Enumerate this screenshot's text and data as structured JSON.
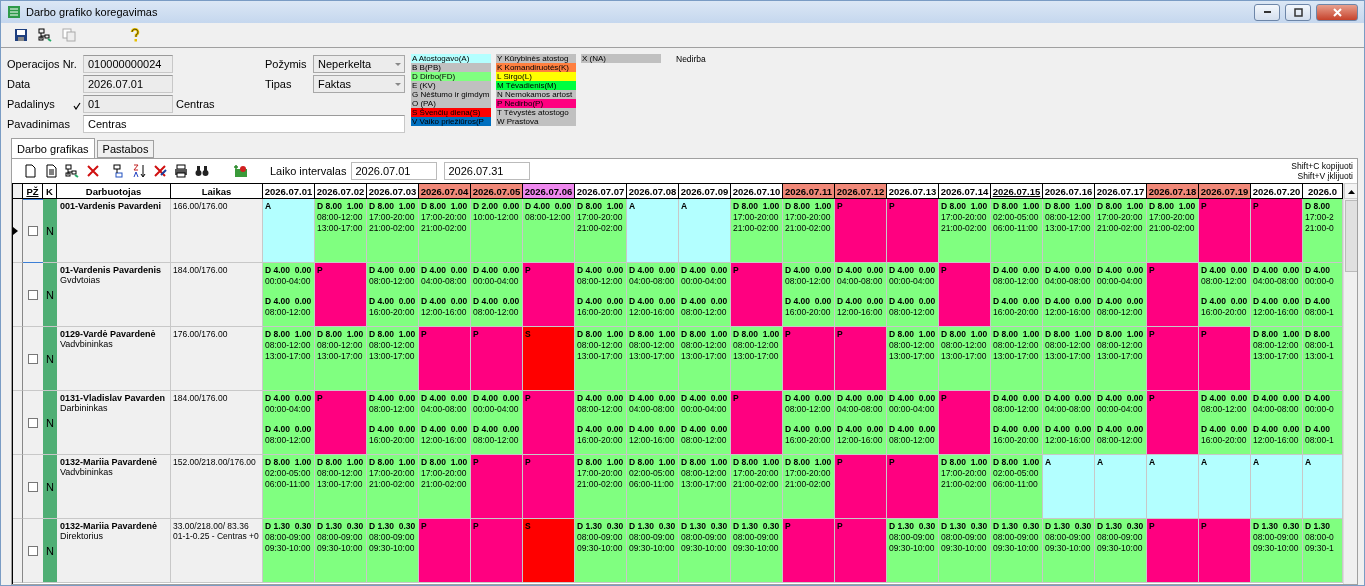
{
  "window": {
    "title": "Darbo grafiko koregavimas"
  },
  "form": {
    "operation_no": {
      "label": "Operacijos Nr.",
      "value": "010000000024"
    },
    "date": {
      "label": "Data",
      "value": "2026.07.01"
    },
    "unit": {
      "label": "Padalinys",
      "code": "01",
      "name": "Centras"
    },
    "title_field": {
      "label": "Pavadinimas",
      "value": "Centras"
    },
    "sign": {
      "label": "Požymis",
      "value": "Neperkelta"
    },
    "type": {
      "label": "Tipas",
      "value": "Faktas"
    }
  },
  "legend": {
    "columns": [
      [
        {
          "text": "A Atostogavo(A)",
          "color": "#b3ffff"
        },
        {
          "text": "B B(PB)",
          "color": "#c0c0c0"
        },
        {
          "text": "D Dirbo(FD)",
          "color": "#80ff80"
        },
        {
          "text": "E (KV)",
          "color": "#c0c0c0"
        },
        {
          "text": "G Nėštumo ir gimdym",
          "color": "#c0c0c0"
        },
        {
          "text": "O (PA)",
          "color": "#c0c0c0"
        },
        {
          "text": "S Švenčių diena(S)",
          "color": "#ff0000"
        },
        {
          "text": "V Vaiko priežiūros(P",
          "color": "#0070c0"
        }
      ],
      [
        {
          "text": "Y Kūrybinės atostog",
          "color": "#c0c0c0"
        },
        {
          "text": "K Komandiruotės(K)",
          "color": "#ff8040"
        },
        {
          "text": "L Sirgo(L)",
          "color": "#ffff00"
        },
        {
          "text": "M Tėvadienis(M)",
          "color": "#00ff40"
        },
        {
          "text": "N Nemokamos artost",
          "color": "#c0c0c0"
        },
        {
          "text": "P Nedirbo(P)",
          "color": "#ff0080"
        },
        {
          "text": "T Tėvystės atostogo",
          "color": "#c0c0c0"
        },
        {
          "text": "W Prastova",
          "color": "#c0c0c0"
        }
      ],
      [
        {
          "text": "X (NA)",
          "color": "#c0c0c0"
        }
      ]
    ],
    "note": "Nedirba"
  },
  "tabs": [
    {
      "label": "Darbo grafikas",
      "selected": true
    },
    {
      "label": "Pastabos",
      "selected": false
    }
  ],
  "schedule": {
    "interval": {
      "label": "Laiko intervalas",
      "from": "2026.07.01",
      "to": "2026.07.31"
    },
    "hints": [
      "Shift+C kopijuoti",
      "Shift+V įklijuoti"
    ],
    "columns": {
      "check": "PŽ",
      "k": "K",
      "employee": "Darbuotojas",
      "hours": "Laikas"
    },
    "dates": [
      {
        "label": "2026.07.01",
        "kind": "weekday"
      },
      {
        "label": "2026.07.02",
        "kind": "weekday"
      },
      {
        "label": "2026.07.03",
        "kind": "weekday"
      },
      {
        "label": "2026.07.04",
        "kind": "weekend"
      },
      {
        "label": "2026.07.05",
        "kind": "weekend"
      },
      {
        "label": "2026.07.06",
        "kind": "holiday"
      },
      {
        "label": "2026.07.07",
        "kind": "weekday"
      },
      {
        "label": "2026.07.08",
        "kind": "weekday"
      },
      {
        "label": "2026.07.09",
        "kind": "weekday"
      },
      {
        "label": "2026.07.10",
        "kind": "weekday"
      },
      {
        "label": "2026.07.11",
        "kind": "weekend"
      },
      {
        "label": "2026.07.12",
        "kind": "weekend"
      },
      {
        "label": "2026.07.13",
        "kind": "weekday"
      },
      {
        "label": "2026.07.14",
        "kind": "weekday"
      },
      {
        "label": "2026.07.15",
        "kind": "today"
      },
      {
        "label": "2026.07.16",
        "kind": "weekday"
      },
      {
        "label": "2026.07.17",
        "kind": "weekday"
      },
      {
        "label": "2026.07.18",
        "kind": "weekend"
      },
      {
        "label": "2026.07.19",
        "kind": "weekend"
      },
      {
        "label": "2026.07.20",
        "kind": "weekday"
      },
      {
        "label": "2026.0",
        "kind": "weekday"
      }
    ],
    "rows": [
      {
        "selected": true,
        "checked": false,
        "k": "N",
        "name": "001-Vardenis Pavardeni",
        "hours": [
          "166.00/176.00"
        ],
        "cells": [
          {
            "kind": "absence",
            "blocks": [
              [
                "A"
              ]
            ]
          },
          {
            "kind": "work",
            "blocks": [
              [
                "D 8.00  1.00",
                "08:00-12:00",
                "13:00-17:00"
              ]
            ]
          },
          {
            "kind": "work",
            "blocks": [
              [
                "D 8.00  1.00",
                "17:00-20:00",
                "21:00-02:00"
              ]
            ]
          },
          {
            "kind": "work",
            "blocks": [
              [
                "D 8.00  1.00",
                "17:00-20:00",
                "21:00-02:00"
              ]
            ]
          },
          {
            "kind": "work",
            "blocks": [
              [
                "D 2.00  0.00",
                "10:00-12:00"
              ]
            ]
          },
          {
            "kind": "work",
            "blocks": [
              [
                "D 4.00  0.00",
                "08:00-12:00"
              ]
            ]
          },
          {
            "kind": "work",
            "blocks": [
              [
                "D 8.00  1.00",
                "17:00-20:00",
                "21:00-02:00"
              ]
            ]
          },
          {
            "kind": "absence",
            "blocks": [
              [
                "A"
              ]
            ]
          },
          {
            "kind": "absence",
            "blocks": [
              [
                "A"
              ]
            ]
          },
          {
            "kind": "work",
            "blocks": [
              [
                "D 8.00  1.00",
                "17:00-20:00",
                "21:00-02:00"
              ]
            ]
          },
          {
            "kind": "work",
            "blocks": [
              [
                "D 8.00  1.00",
                "17:00-20:00",
                "21:00-02:00"
              ]
            ]
          },
          {
            "kind": "off",
            "blocks": [
              [
                "P"
              ]
            ]
          },
          {
            "kind": "off",
            "blocks": [
              [
                "P"
              ]
            ]
          },
          {
            "kind": "work",
            "blocks": [
              [
                "D 8.00  1.00",
                "17:00-20:00",
                "21:00-02:00"
              ]
            ]
          },
          {
            "kind": "work",
            "blocks": [
              [
                "D 8.00  1.00",
                "02:00-05:00",
                "06:00-11:00"
              ]
            ]
          },
          {
            "kind": "work",
            "blocks": [
              [
                "D 8.00  1.00",
                "08:00-12:00",
                "13:00-17:00"
              ]
            ]
          },
          {
            "kind": "work",
            "blocks": [
              [
                "D 8.00  1.00",
                "17:00-20:00",
                "21:00-02:00"
              ]
            ]
          },
          {
            "kind": "work",
            "blocks": [
              [
                "D 8.00  1.00",
                "17:00-20:00",
                "21:00-02:00"
              ]
            ]
          },
          {
            "kind": "off",
            "blocks": [
              [
                "P"
              ]
            ]
          },
          {
            "kind": "off",
            "blocks": [
              [
                "P"
              ]
            ]
          },
          {
            "kind": "work",
            "blocks": [
              [
                "D 8.00",
                "17:00-2",
                "21:00-0"
              ]
            ]
          }
        ]
      },
      {
        "selected": false,
        "checked": false,
        "k": "N",
        "name": "01-Vardenis Pavardenis",
        "role": "Gvdvtoias",
        "hours": [
          "184.00/176.00"
        ],
        "cells": [
          {
            "kind": "work",
            "blocks": [
              [
                "D 4.00  0.00",
                "00:00-04:00"
              ],
              [
                "D 4.00  0.00",
                "08:00-12:00"
              ]
            ]
          },
          {
            "kind": "off",
            "blocks": [
              [
                "P"
              ]
            ]
          },
          {
            "kind": "work",
            "blocks": [
              [
                "D 4.00  0.00",
                "08:00-12:00"
              ],
              [
                "D 4.00  0.00",
                "16:00-20:00"
              ]
            ]
          },
          {
            "kind": "work",
            "blocks": [
              [
                "D 4.00  0.00",
                "04:00-08:00"
              ],
              [
                "D 4.00  0.00",
                "12:00-16:00"
              ]
            ]
          },
          {
            "kind": "work",
            "blocks": [
              [
                "D 4.00  0.00",
                "00:00-04:00"
              ],
              [
                "D 4.00  0.00",
                "08:00-12:00"
              ]
            ]
          },
          {
            "kind": "off",
            "blocks": [
              [
                "P"
              ]
            ]
          },
          {
            "kind": "work",
            "blocks": [
              [
                "D 4.00  0.00",
                "08:00-12:00"
              ],
              [
                "D 4.00  0.00",
                "16:00-20:00"
              ]
            ]
          },
          {
            "kind": "work",
            "blocks": [
              [
                "D 4.00  0.00",
                "04:00-08:00"
              ],
              [
                "D 4.00  0.00",
                "12:00-16:00"
              ]
            ]
          },
          {
            "kind": "work",
            "blocks": [
              [
                "D 4.00  0.00",
                "00:00-04:00"
              ],
              [
                "D 4.00  0.00",
                "08:00-12:00"
              ]
            ]
          },
          {
            "kind": "off",
            "blocks": [
              [
                "P"
              ]
            ]
          },
          {
            "kind": "work",
            "blocks": [
              [
                "D 4.00  0.00",
                "08:00-12:00"
              ],
              [
                "D 4.00  0.00",
                "16:00-20:00"
              ]
            ]
          },
          {
            "kind": "work",
            "blocks": [
              [
                "D 4.00  0.00",
                "04:00-08:00"
              ],
              [
                "D 4.00  0.00",
                "12:00-16:00"
              ]
            ]
          },
          {
            "kind": "work",
            "blocks": [
              [
                "D 4.00  0.00",
                "00:00-04:00"
              ],
              [
                "D 4.00  0.00",
                "08:00-12:00"
              ]
            ]
          },
          {
            "kind": "off",
            "blocks": [
              [
                "P"
              ]
            ]
          },
          {
            "kind": "work",
            "blocks": [
              [
                "D 4.00  0.00",
                "08:00-12:00"
              ],
              [
                "D 4.00  0.00",
                "16:00-20:00"
              ]
            ]
          },
          {
            "kind": "work",
            "blocks": [
              [
                "D 4.00  0.00",
                "04:00-08:00"
              ],
              [
                "D 4.00  0.00",
                "12:00-16:00"
              ]
            ]
          },
          {
            "kind": "work",
            "blocks": [
              [
                "D 4.00  0.00",
                "00:00-04:00"
              ],
              [
                "D 4.00  0.00",
                "08:00-12:00"
              ]
            ]
          },
          {
            "kind": "off",
            "blocks": [
              [
                "P"
              ]
            ]
          },
          {
            "kind": "work",
            "blocks": [
              [
                "D 4.00  0.00",
                "08:00-12:00"
              ],
              [
                "D 4.00  0.00",
                "16:00-20:00"
              ]
            ]
          },
          {
            "kind": "work",
            "blocks": [
              [
                "D 4.00  0.00",
                "04:00-08:00"
              ],
              [
                "D 4.00  0.00",
                "12:00-16:00"
              ]
            ]
          },
          {
            "kind": "work",
            "blocks": [
              [
                "D 4.00",
                "00:00-0"
              ],
              [
                "D 4.00",
                "08:00-1"
              ]
            ]
          }
        ]
      },
      {
        "selected": false,
        "checked": false,
        "k": "N",
        "name": "0129-Vardė Pavardenė",
        "role": "Vadvbininkas",
        "hours": [
          "176.00/176.00"
        ],
        "cells": [
          {
            "kind": "work",
            "blocks": [
              [
                "D 8.00  1.00",
                "08:00-12:00",
                "13:00-17:00"
              ]
            ]
          },
          {
            "kind": "work",
            "blocks": [
              [
                "D 8.00  1.00",
                "08:00-12:00",
                "13:00-17:00"
              ]
            ]
          },
          {
            "kind": "work",
            "blocks": [
              [
                "D 8.00  1.00",
                "08:00-12:00",
                "13:00-17:00"
              ]
            ]
          },
          {
            "kind": "off",
            "blocks": [
              [
                "P"
              ]
            ]
          },
          {
            "kind": "off",
            "blocks": [
              [
                "P"
              ]
            ]
          },
          {
            "kind": "holiday",
            "blocks": [
              [
                "S"
              ]
            ]
          },
          {
            "kind": "work",
            "blocks": [
              [
                "D 8.00  1.00",
                "08:00-12:00",
                "13:00-17:00"
              ]
            ]
          },
          {
            "kind": "work",
            "blocks": [
              [
                "D 8.00  1.00",
                "08:00-12:00",
                "13:00-17:00"
              ]
            ]
          },
          {
            "kind": "work",
            "blocks": [
              [
                "D 8.00  1.00",
                "08:00-12:00",
                "13:00-17:00"
              ]
            ]
          },
          {
            "kind": "work",
            "blocks": [
              [
                "D 8.00  1.00",
                "08:00-12:00",
                "13:00-17:00"
              ]
            ]
          },
          {
            "kind": "off",
            "blocks": [
              [
                "P"
              ]
            ]
          },
          {
            "kind": "off",
            "blocks": [
              [
                "P"
              ]
            ]
          },
          {
            "kind": "work",
            "blocks": [
              [
                "D 8.00  1.00",
                "08:00-12:00",
                "13:00-17:00"
              ]
            ]
          },
          {
            "kind": "work",
            "blocks": [
              [
                "D 8.00  1.00",
                "08:00-12:00",
                "13:00-17:00"
              ]
            ]
          },
          {
            "kind": "work",
            "blocks": [
              [
                "D 8.00  1.00",
                "08:00-12:00",
                "13:00-17:00"
              ]
            ]
          },
          {
            "kind": "work",
            "blocks": [
              [
                "D 8.00  1.00",
                "08:00-12:00",
                "13:00-17:00"
              ]
            ]
          },
          {
            "kind": "work",
            "blocks": [
              [
                "D 8.00  1.00",
                "08:00-12:00",
                "13:00-17:00"
              ]
            ]
          },
          {
            "kind": "off",
            "blocks": [
              [
                "P"
              ]
            ]
          },
          {
            "kind": "off",
            "blocks": [
              [
                "P"
              ]
            ]
          },
          {
            "kind": "work",
            "blocks": [
              [
                "D 8.00  1.00",
                "08:00-12:00",
                "13:00-17:00"
              ]
            ]
          },
          {
            "kind": "work",
            "blocks": [
              [
                "D 8.00",
                "08:00-1",
                "13:00-1"
              ]
            ]
          }
        ]
      },
      {
        "selected": false,
        "checked": false,
        "k": "N",
        "name": "0131-Vladislav Pavarden",
        "role": "Darbininkas",
        "hours": [
          "184.00/176.00"
        ],
        "cells": [
          {
            "kind": "work",
            "blocks": [
              [
                "D 4.00  0.00",
                "00:00-04:00"
              ],
              [
                "D 4.00  0.00",
                "08:00-12:00"
              ]
            ]
          },
          {
            "kind": "off",
            "blocks": [
              [
                "P"
              ]
            ]
          },
          {
            "kind": "work",
            "blocks": [
              [
                "D 4.00  0.00",
                "08:00-12:00"
              ],
              [
                "D 4.00  0.00",
                "16:00-20:00"
              ]
            ]
          },
          {
            "kind": "work",
            "blocks": [
              [
                "D 4.00  0.00",
                "04:00-08:00"
              ],
              [
                "D 4.00  0.00",
                "12:00-16:00"
              ]
            ]
          },
          {
            "kind": "work",
            "blocks": [
              [
                "D 4.00  0.00",
                "00:00-04:00"
              ],
              [
                "D 4.00  0.00",
                "08:00-12:00"
              ]
            ]
          },
          {
            "kind": "off",
            "blocks": [
              [
                "P"
              ]
            ]
          },
          {
            "kind": "work",
            "blocks": [
              [
                "D 4.00  0.00",
                "08:00-12:00"
              ],
              [
                "D 4.00  0.00",
                "16:00-20:00"
              ]
            ]
          },
          {
            "kind": "work",
            "blocks": [
              [
                "D 4.00  0.00",
                "04:00-08:00"
              ],
              [
                "D 4.00  0.00",
                "12:00-16:00"
              ]
            ]
          },
          {
            "kind": "work",
            "blocks": [
              [
                "D 4.00  0.00",
                "00:00-04:00"
              ],
              [
                "D 4.00  0.00",
                "08:00-12:00"
              ]
            ]
          },
          {
            "kind": "off",
            "blocks": [
              [
                "P"
              ]
            ]
          },
          {
            "kind": "work",
            "blocks": [
              [
                "D 4.00  0.00",
                "08:00-12:00"
              ],
              [
                "D 4.00  0.00",
                "16:00-20:00"
              ]
            ]
          },
          {
            "kind": "work",
            "blocks": [
              [
                "D 4.00  0.00",
                "04:00-08:00"
              ],
              [
                "D 4.00  0.00",
                "12:00-16:00"
              ]
            ]
          },
          {
            "kind": "work",
            "blocks": [
              [
                "D 4.00  0.00",
                "00:00-04:00"
              ],
              [
                "D 4.00  0.00",
                "08:00-12:00"
              ]
            ]
          },
          {
            "kind": "off",
            "blocks": [
              [
                "P"
              ]
            ]
          },
          {
            "kind": "work",
            "blocks": [
              [
                "D 4.00  0.00",
                "08:00-12:00"
              ],
              [
                "D 4.00  0.00",
                "16:00-20:00"
              ]
            ]
          },
          {
            "kind": "work",
            "blocks": [
              [
                "D 4.00  0.00",
                "04:00-08:00"
              ],
              [
                "D 4.00  0.00",
                "12:00-16:00"
              ]
            ]
          },
          {
            "kind": "work",
            "blocks": [
              [
                "D 4.00  0.00",
                "00:00-04:00"
              ],
              [
                "D 4.00  0.00",
                "08:00-12:00"
              ]
            ]
          },
          {
            "kind": "off",
            "blocks": [
              [
                "P"
              ]
            ]
          },
          {
            "kind": "work",
            "blocks": [
              [
                "D 4.00  0.00",
                "08:00-12:00"
              ],
              [
                "D 4.00  0.00",
                "16:00-20:00"
              ]
            ]
          },
          {
            "kind": "work",
            "blocks": [
              [
                "D 4.00  0.00",
                "04:00-08:00"
              ],
              [
                "D 4.00  0.00",
                "12:00-16:00"
              ]
            ]
          },
          {
            "kind": "work",
            "blocks": [
              [
                "D 4.00",
                "00:00-0"
              ],
              [
                "D 4.00",
                "08:00-1"
              ]
            ]
          }
        ]
      },
      {
        "selected": false,
        "checked": false,
        "k": "N",
        "name": "0132-Mariia Pavardenė",
        "role": "Vadvbininkas",
        "hours": [
          "152.00/218.00/176.00"
        ],
        "cells": [
          {
            "kind": "work",
            "blocks": [
              [
                "D 8.00  1.00",
                "02:00-05:00",
                "06:00-11:00"
              ]
            ]
          },
          {
            "kind": "work",
            "blocks": [
              [
                "D 8.00  1.00",
                "08:00-12:00",
                "13:00-17:00"
              ]
            ]
          },
          {
            "kind": "work",
            "blocks": [
              [
                "D 8.00  1.00",
                "17:00-20:00",
                "21:00-02:00"
              ]
            ]
          },
          {
            "kind": "work",
            "blocks": [
              [
                "D 8.00  1.00",
                "17:00-20:00",
                "21:00-02:00"
              ]
            ]
          },
          {
            "kind": "off",
            "blocks": [
              [
                "P"
              ]
            ]
          },
          {
            "kind": "off",
            "blocks": [
              [
                "P"
              ]
            ]
          },
          {
            "kind": "work",
            "blocks": [
              [
                "D 8.00  1.00",
                "17:00-20:00",
                "21:00-02:00"
              ]
            ]
          },
          {
            "kind": "work",
            "blocks": [
              [
                "D 8.00  1.00",
                "02:00-05:00",
                "06:00-11:00"
              ]
            ]
          },
          {
            "kind": "work",
            "blocks": [
              [
                "D 8.00  1.00",
                "08:00-12:00",
                "13:00-17:00"
              ]
            ]
          },
          {
            "kind": "work",
            "blocks": [
              [
                "D 8.00  1.00",
                "17:00-20:00",
                "21:00-02:00"
              ]
            ]
          },
          {
            "kind": "work",
            "blocks": [
              [
                "D 8.00  1.00",
                "17:00-20:00",
                "21:00-02:00"
              ]
            ]
          },
          {
            "kind": "off",
            "blocks": [
              [
                "P"
              ]
            ]
          },
          {
            "kind": "off",
            "blocks": [
              [
                "P"
              ]
            ]
          },
          {
            "kind": "work",
            "blocks": [
              [
                "D 8.00  1.00",
                "17:00-20:00",
                "21:00-02:00"
              ]
            ]
          },
          {
            "kind": "work",
            "blocks": [
              [
                "D 8.00  1.00",
                "02:00-05:00",
                "06:00-11:00"
              ]
            ]
          },
          {
            "kind": "absence",
            "blocks": [
              [
                "A"
              ]
            ]
          },
          {
            "kind": "absence",
            "blocks": [
              [
                "A"
              ]
            ]
          },
          {
            "kind": "absence",
            "blocks": [
              [
                "A"
              ]
            ]
          },
          {
            "kind": "absence",
            "blocks": [
              [
                "A"
              ]
            ]
          },
          {
            "kind": "absence",
            "blocks": [
              [
                "A"
              ]
            ]
          },
          {
            "kind": "absence",
            "blocks": [
              [
                "A"
              ]
            ]
          }
        ]
      },
      {
        "selected": false,
        "checked": false,
        "k": "N",
        "name": "0132-Mariia Pavardenė",
        "role": "Direktorius",
        "hours": [
          "33.00/218.00/ 83.36",
          "01-1-0.25 - Centras +0"
        ],
        "cells": [
          {
            "kind": "work",
            "blocks": [
              [
                "D 1.30  0.30",
                "08:00-09:00",
                "09:30-10:00"
              ]
            ]
          },
          {
            "kind": "work",
            "blocks": [
              [
                "D 1.30  0.30",
                "08:00-09:00",
                "09:30-10:00"
              ]
            ]
          },
          {
            "kind": "work",
            "blocks": [
              [
                "D 1.30  0.30",
                "08:00-09:00",
                "09:30-10:00"
              ]
            ]
          },
          {
            "kind": "off",
            "blocks": [
              [
                "P"
              ]
            ]
          },
          {
            "kind": "off",
            "blocks": [
              [
                "P"
              ]
            ]
          },
          {
            "kind": "holiday",
            "blocks": [
              [
                "S"
              ]
            ]
          },
          {
            "kind": "work",
            "blocks": [
              [
                "D 1.30  0.30",
                "08:00-09:00",
                "09:30-10:00"
              ]
            ]
          },
          {
            "kind": "work",
            "blocks": [
              [
                "D 1.30  0.30",
                "08:00-09:00",
                "09:30-10:00"
              ]
            ]
          },
          {
            "kind": "work",
            "blocks": [
              [
                "D 1.30  0.30",
                "08:00-09:00",
                "09:30-10:00"
              ]
            ]
          },
          {
            "kind": "work",
            "blocks": [
              [
                "D 1.30  0.30",
                "08:00-09:00",
                "09:30-10:00"
              ]
            ]
          },
          {
            "kind": "off",
            "blocks": [
              [
                "P"
              ]
            ]
          },
          {
            "kind": "off",
            "blocks": [
              [
                "P"
              ]
            ]
          },
          {
            "kind": "work",
            "blocks": [
              [
                "D 1.30  0.30",
                "08:00-09:00",
                "09:30-10:00"
              ]
            ]
          },
          {
            "kind": "work",
            "blocks": [
              [
                "D 1.30  0.30",
                "08:00-09:00",
                "09:30-10:00"
              ]
            ]
          },
          {
            "kind": "work",
            "blocks": [
              [
                "D 1.30  0.30",
                "08:00-09:00",
                "09:30-10:00"
              ]
            ]
          },
          {
            "kind": "work",
            "blocks": [
              [
                "D 1.30  0.30",
                "08:00-09:00",
                "09:30-10:00"
              ]
            ]
          },
          {
            "kind": "work",
            "blocks": [
              [
                "D 1.30  0.30",
                "08:00-09:00",
                "09:30-10:00"
              ]
            ]
          },
          {
            "kind": "off",
            "blocks": [
              [
                "P"
              ]
            ]
          },
          {
            "kind": "off",
            "blocks": [
              [
                "P"
              ]
            ]
          },
          {
            "kind": "work",
            "blocks": [
              [
                "D 1.30  0.30",
                "08:00-09:00",
                "09:30-10:00"
              ]
            ]
          },
          {
            "kind": "work",
            "blocks": [
              [
                "D 1.30",
                "08:00-0",
                "09:30-1"
              ]
            ]
          }
        ]
      }
    ]
  }
}
